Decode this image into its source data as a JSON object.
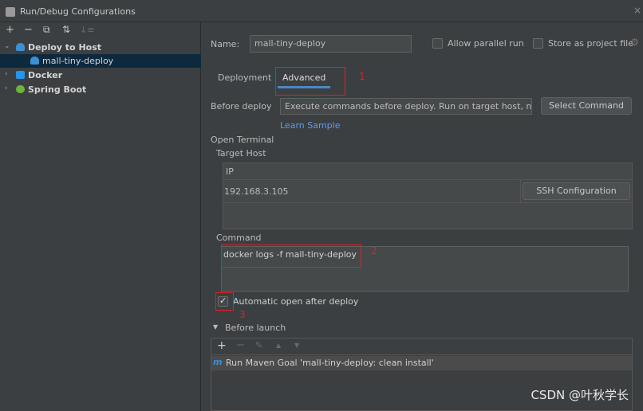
{
  "window": {
    "title": "Run/Debug Configurations",
    "close_glyph": "×"
  },
  "toolbar": {
    "add": "+",
    "remove": "−",
    "copy": "⧉",
    "move": "⇅",
    "sort": "↓≡"
  },
  "tree": {
    "items": [
      {
        "label": "Deploy to Host",
        "expanded": true
      },
      {
        "label": "mall-tiny-deploy",
        "selected": true
      },
      {
        "label": "Docker",
        "expanded": false
      },
      {
        "label": "Spring Boot",
        "expanded": false
      }
    ]
  },
  "config": {
    "name_label": "Name:",
    "name_value": "mall-tiny-deploy",
    "allow_parallel_label": "Allow parallel run",
    "store_project_label": "Store as project file"
  },
  "tabs": [
    {
      "label": "Deployment",
      "active": false
    },
    {
      "label": "Advanced",
      "active": true
    }
  ],
  "advanced": {
    "before_deploy_label": "Before deploy",
    "before_deploy_value": "Execute commands before deploy. Run on target host, not lo",
    "select_command_label": "Select Command",
    "learn_sample_label": "Learn Sample",
    "open_terminal_label": "Open Terminal",
    "target_host_label": "Target Host",
    "host_table": {
      "header": "IP",
      "rows": [
        {
          "ip": "192.168.3.105",
          "action": "SSH Configuration"
        }
      ]
    },
    "command_label": "Command",
    "command_value": "docker logs -f mall-tiny-deploy",
    "auto_open_label": "Automatic open after deploy",
    "auto_open_checked": true
  },
  "before_launch": {
    "title": "Before launch",
    "toolbar": {
      "add": "+",
      "remove": "−",
      "edit": "✎",
      "up": "▲",
      "down": "▼"
    },
    "items": [
      {
        "label": "Run Maven Goal 'mall-tiny-deploy: clean install'"
      }
    ]
  },
  "annotations": {
    "one": "1",
    "two": "2",
    "three": "3"
  },
  "watermark": "CSDN @叶秋学长",
  "colors": {
    "accent": "#4a88c7",
    "selection": "#0d293e",
    "annotation": "#e32020",
    "link": "#589df6"
  }
}
